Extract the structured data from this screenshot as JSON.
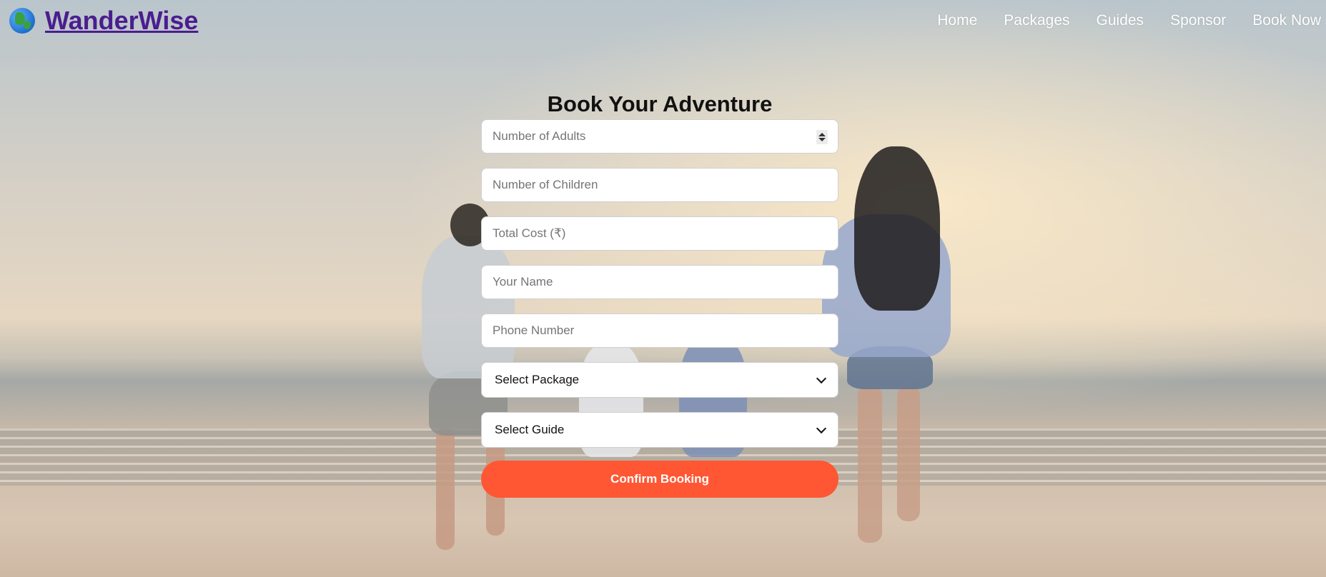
{
  "header": {
    "logo_icon": "globe-icon",
    "logo_text": "WanderWise",
    "nav": [
      "Home",
      "Packages",
      "Guides",
      "Sponsor",
      "Book Now"
    ]
  },
  "form": {
    "title": "Book Your Adventure",
    "adults_placeholder": "Number of Adults",
    "children_placeholder": "Number of Children",
    "cost_placeholder": "Total Cost (₹)",
    "name_placeholder": "Your Name",
    "phone_placeholder": "Phone Number",
    "package_select": "Select Package",
    "guide_select": "Select Guide",
    "submit_label": "Confirm Booking"
  },
  "colors": {
    "logo": "#4b1d8f",
    "button": "#ff5733",
    "nav_text": "#ffffff"
  }
}
